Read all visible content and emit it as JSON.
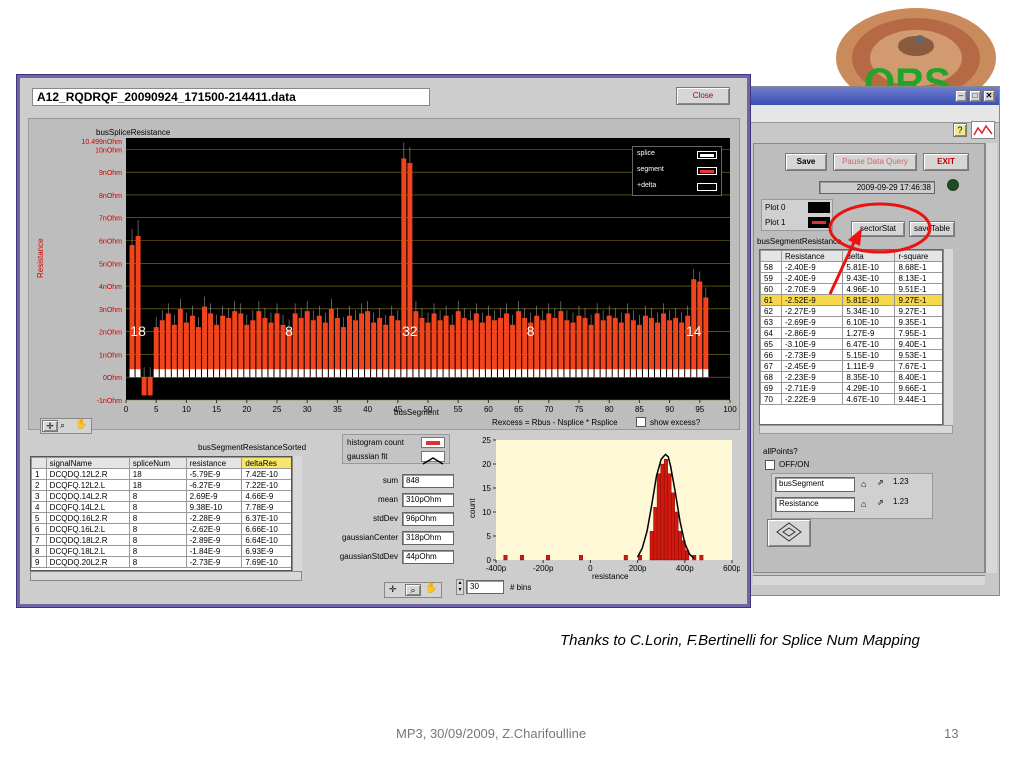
{
  "front_window": {
    "title": "A12_RQDRQF_20090924_171500-214411.data",
    "close_label": "Close",
    "chart_title": "busSpliceResistance",
    "ylabel": "Resistance",
    "y_top_label": "10.499nOhm",
    "y_ticks": [
      "10nOhm",
      "9nOhm",
      "8nOhm",
      "7nOhm",
      "6nOhm",
      "5nOhm",
      "4nOhm",
      "3nOhm",
      "2nOhm",
      "1nOhm",
      "0Ohm",
      "-1nOhm"
    ],
    "x_ticks": [
      "0",
      "5",
      "10",
      "15",
      "20",
      "25",
      "30",
      "35",
      "40",
      "45",
      "50",
      "55",
      "60",
      "65",
      "70",
      "75",
      "80",
      "85",
      "90",
      "95",
      "100"
    ],
    "xlabel": "busSegment",
    "legend": [
      "splice",
      "segment",
      "+delta"
    ],
    "overlay_numbers": [
      "18",
      "8",
      "32",
      "8",
      "14"
    ],
    "formula": "Rexcess = Rbus - Nsplice * Rsplice",
    "show_excess_label": "show excess?",
    "table_title": "busSegmentResistanceSorted",
    "table_headers": [
      "",
      "signalName",
      "spliceNum",
      "resistance",
      "deltaRes"
    ],
    "table_rows": [
      [
        "1",
        "DCQDQ.12L2.R",
        "18",
        "-5.79E-9",
        "7.42E-10"
      ],
      [
        "2",
        "DCQFQ.12L2.L",
        "18",
        "-6.27E-9",
        "7.22E-10"
      ],
      [
        "3",
        "DCQDQ.14L2.R",
        "8",
        "2.69E-9",
        "4.66E-9"
      ],
      [
        "4",
        "DCQFQ.14L2.L",
        "8",
        "9.38E-10",
        "7.78E-9"
      ],
      [
        "5",
        "DCQDQ.16L2.R",
        "8",
        "-2.28E-9",
        "6.37E-10"
      ],
      [
        "6",
        "DCQFQ.16L2.L",
        "8",
        "-2.62E-9",
        "6.66E-10"
      ],
      [
        "7",
        "DCQDQ.18L2.R",
        "8",
        "-2.89E-9",
        "6.64E-10"
      ],
      [
        "8",
        "DCQFQ.18L2.L",
        "8",
        "-1.84E-9",
        "6.93E-9"
      ],
      [
        "9",
        "DCQDQ.20L2.R",
        "8",
        "-2.73E-9",
        "7.69E-10"
      ]
    ],
    "hist_count_label": "histogram count",
    "gauss_fit_label": "gaussian fit",
    "stats": [
      {
        "label": "sum",
        "value": "848"
      },
      {
        "label": "mean",
        "value": "310pOhm"
      },
      {
        "label": "stdDev",
        "value": "96pOhm"
      },
      {
        "label": "gaussianCenter",
        "value": "318pOhm"
      },
      {
        "label": "gaussianStdDev",
        "value": "44pOhm"
      }
    ],
    "bins_value": "30",
    "bins_label": "# bins",
    "hist": {
      "ylabel": "count",
      "xlabel": "resistance",
      "y_ticks": [
        "25",
        "20",
        "15",
        "10",
        "5",
        "0"
      ],
      "x_ticks": [
        "-400p",
        "-200p",
        "0",
        "200p",
        "400p",
        "600p"
      ]
    }
  },
  "back_window": {
    "save_label": "Save",
    "pause_label": "Pause Data Query",
    "exit_label": "EXIT",
    "timestamp": "2009-09-29 17:46:38",
    "plot0_label": "Plot 0",
    "plot1_label": "Plot 1",
    "sector_stat_label": "sectorStat",
    "save_table_label": "saveTable",
    "table_title": "busSegmentResistance",
    "table_headers": [
      "",
      "Resistance",
      "delta",
      "r-square"
    ],
    "table_rows": [
      [
        "58",
        "-2.40E-9",
        "5.81E-10",
        "8.68E-1"
      ],
      [
        "59",
        "-2.40E-9",
        "9.43E-10",
        "8.13E-1"
      ],
      [
        "60",
        "-2.70E-9",
        "4.96E-10",
        "9.51E-1"
      ],
      [
        "61",
        "-2.52E-9",
        "5.81E-10",
        "9.27E-1"
      ],
      [
        "62",
        "-2.27E-9",
        "5.34E-10",
        "9.27E-1"
      ],
      [
        "63",
        "-2.69E-9",
        "6.10E-10",
        "9.35E-1"
      ],
      [
        "64",
        "-2.86E-9",
        "1.27E-9",
        "7.95E-1"
      ],
      [
        "65",
        "-3.10E-9",
        "6.47E-10",
        "9.40E-1"
      ],
      [
        "66",
        "-2.73E-9",
        "5.15E-10",
        "9.53E-1"
      ],
      [
        "67",
        "-2.45E-9",
        "1.11E-9",
        "7.67E-1"
      ],
      [
        "68",
        "-2.23E-9",
        "8.35E-10",
        "8.40E-1"
      ],
      [
        "69",
        "-2.71E-9",
        "4.29E-10",
        "9.66E-1"
      ],
      [
        "70",
        "-2.22E-9",
        "4.67E-10",
        "9.44E-1"
      ]
    ],
    "all_points_label": "allPoints?",
    "off_on_label": "OFF/ON",
    "bus_segment_label": "busSegment",
    "resistance_label": "Resistance",
    "fmt1": "1.23",
    "fmt2": "1.23"
  },
  "caption": "Thanks to C.Lorin, F.Bertinelli for Splice Num Mapping",
  "footer": "MP3, 30/09/2009, Z.Charifoulline",
  "page_number": "13",
  "logo_text": "ORS",
  "chart_data": [
    {
      "type": "bar",
      "title": "busSpliceResistance",
      "xlabel": "busSegment",
      "ylabel": "Resistance",
      "ylim": [
        -1,
        10.499
      ],
      "xlim": [
        0,
        100
      ],
      "series": [
        {
          "name": "segment",
          "unit": "nOhm",
          "x": [
            1,
            2,
            3,
            4,
            5,
            6,
            7,
            8,
            9,
            10,
            11,
            12,
            13,
            14,
            15,
            16,
            17,
            18,
            19,
            20,
            21,
            22,
            23,
            24,
            25,
            26,
            27,
            28,
            29,
            30,
            31,
            32,
            33,
            34,
            35,
            36,
            37,
            38,
            39,
            40,
            41,
            42,
            43,
            44,
            45,
            46,
            47,
            48,
            49,
            50,
            51,
            52,
            53,
            54,
            55,
            56,
            57,
            58,
            59,
            60,
            61,
            62,
            63,
            64,
            65,
            66,
            67,
            68,
            69,
            70,
            71,
            72,
            73,
            74,
            75,
            76,
            77,
            78,
            79,
            80,
            81,
            82,
            83,
            84,
            85,
            86,
            87,
            88,
            89,
            90,
            91,
            92,
            93,
            94,
            95,
            96
          ],
          "values": [
            5.8,
            6.2,
            -0.8,
            -0.8,
            2.2,
            2.5,
            2.8,
            2.3,
            3.0,
            2.4,
            2.7,
            2.2,
            3.1,
            2.8,
            2.3,
            2.7,
            2.6,
            2.9,
            2.8,
            2.3,
            2.5,
            2.9,
            2.6,
            2.4,
            2.8,
            2.3,
            2.1,
            2.8,
            2.6,
            2.9,
            2.5,
            2.7,
            2.4,
            3.0,
            2.6,
            2.2,
            2.7,
            2.5,
            2.8,
            2.9,
            2.4,
            2.6,
            2.3,
            2.7,
            2.5,
            9.6,
            9.4,
            2.9,
            2.6,
            2.4,
            2.8,
            2.5,
            2.7,
            2.3,
            2.9,
            2.6,
            2.5,
            2.8,
            2.4,
            2.7,
            2.5,
            2.6,
            2.8,
            2.3,
            2.9,
            2.6,
            2.4,
            2.7,
            2.5,
            2.8,
            2.6,
            2.9,
            2.5,
            2.4,
            2.7,
            2.6,
            2.3,
            2.8,
            2.5,
            2.7,
            2.6,
            2.4,
            2.8,
            2.5,
            2.3,
            2.7,
            2.6,
            2.4,
            2.8,
            2.5,
            2.6,
            2.4,
            2.7,
            4.3,
            4.2,
            3.5
          ]
        }
      ]
    },
    {
      "type": "bar",
      "xlabel": "resistance",
      "ylabel": "count",
      "xlim": [
        -400,
        600
      ],
      "ylim": [
        0,
        25
      ],
      "x_unit": "pOhm",
      "series": [
        {
          "name": "histogram count",
          "x": [
            -360,
            -290,
            -180,
            -40,
            150,
            210,
            260,
            275,
            290,
            305,
            320,
            335,
            350,
            365,
            380,
            395,
            410,
            440,
            470
          ],
          "values": [
            1,
            1,
            1,
            1,
            1,
            1,
            6,
            11,
            18,
            20,
            21,
            18,
            14,
            10,
            6,
            4,
            2,
            1,
            1
          ]
        },
        {
          "name": "gaussian fit",
          "x": [
            200,
            220,
            240,
            260,
            280,
            300,
            318,
            330,
            340,
            360,
            380,
            400,
            420,
            440
          ],
          "values": [
            0.6,
            2.5,
            6.0,
            11.5,
            17.5,
            21.0,
            22.0,
            21.5,
            19.5,
            14.0,
            8.0,
            3.5,
            1.2,
            0.3
          ]
        }
      ]
    }
  ]
}
